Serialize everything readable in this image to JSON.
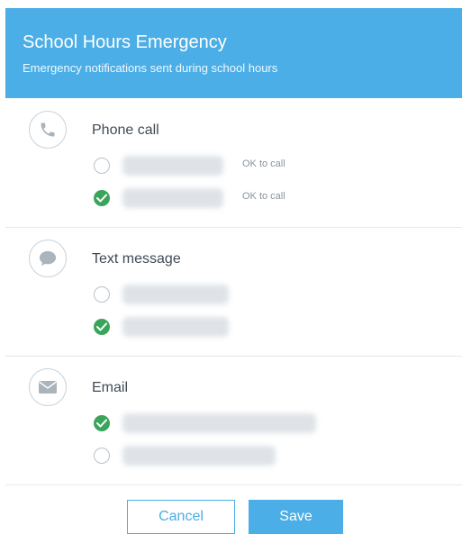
{
  "header": {
    "title": "School Hours Emergency",
    "subtitle": "Emergency notifications sent during school hours"
  },
  "colors": {
    "accent": "#4baee6",
    "check": "#3aa55a"
  },
  "sections": {
    "phone": {
      "label": "Phone call",
      "icon": "phone-icon",
      "options": [
        {
          "value": "",
          "checked": false,
          "note": "OK to call"
        },
        {
          "value": "",
          "checked": true,
          "note": "OK to call"
        }
      ]
    },
    "text": {
      "label": "Text message",
      "icon": "chat-bubble-icon",
      "options": [
        {
          "value": "",
          "checked": false
        },
        {
          "value": "",
          "checked": true
        }
      ]
    },
    "email": {
      "label": "Email",
      "icon": "envelope-icon",
      "options": [
        {
          "value": "",
          "checked": true
        },
        {
          "value": "",
          "checked": false
        }
      ]
    }
  },
  "footer": {
    "cancel_label": "Cancel",
    "save_label": "Save"
  }
}
